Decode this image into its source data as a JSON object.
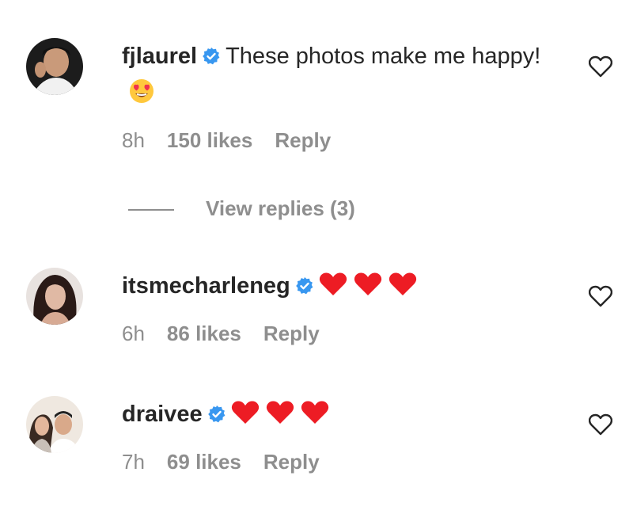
{
  "comments": [
    {
      "username": "fjlaurel",
      "verified": true,
      "text": "These photos make me happy!",
      "emoji": "smiling-face-with-heart-eyes",
      "time": "8h",
      "likes": "150 likes",
      "reply_label": "Reply"
    },
    {
      "username": "itsmecharleneg",
      "verified": true,
      "emoji": "three-red-hearts",
      "time": "6h",
      "likes": "86 likes",
      "reply_label": "Reply"
    },
    {
      "username": "draivee",
      "verified": true,
      "emoji": "three-red-hearts",
      "time": "7h",
      "likes": "69 likes",
      "reply_label": "Reply"
    }
  ],
  "view_replies_label": "View replies (3)",
  "colors": {
    "text": "#262626",
    "muted": "#8e8e8e",
    "verified_blue": "#3897f0",
    "heart_red": "#ed1c24"
  }
}
